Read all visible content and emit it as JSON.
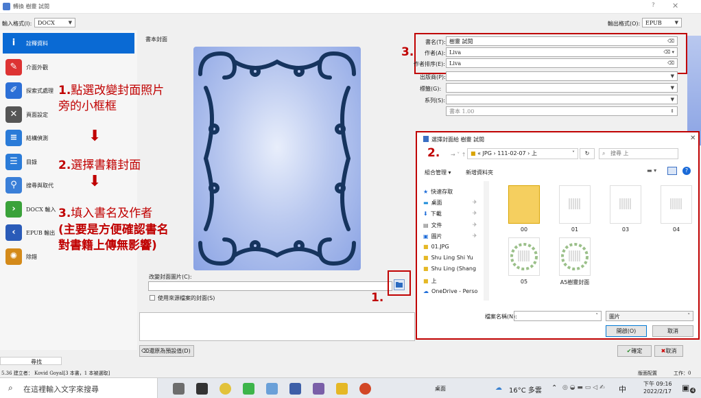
{
  "window": {
    "title": "轉換 樹靈 試閱",
    "help": "?",
    "close": "✕"
  },
  "input_format": {
    "label": "輸入格式(I):",
    "value": "DOCX"
  },
  "output_format": {
    "label": "輸出格式(O):",
    "value": "EPUB"
  },
  "sidebar": {
    "items": [
      {
        "label": "詮釋資料",
        "icon": "info-icon",
        "color": "#0a6ad4"
      },
      {
        "label": "介面外觀",
        "icon": "brush-icon",
        "color": "#d33"
      },
      {
        "label": "探索式處理",
        "icon": "document-edit-icon",
        "color": "#2c6fd6"
      },
      {
        "label": "頁面設定",
        "icon": "tools-icon",
        "color": "#555"
      },
      {
        "label": "結構偵測",
        "icon": "numbered-list-icon",
        "color": "#2a7bd8"
      },
      {
        "label": "目錄",
        "icon": "toc-icon",
        "color": "#2a7bd8"
      },
      {
        "label": "搜尋與取代",
        "icon": "magnifier-icon",
        "color": "#3a7fd8"
      },
      {
        "label": "DOCX 輸入",
        "icon": "chevron-right-icon",
        "color": "#3aa23a"
      },
      {
        "label": "EPUB 輸出",
        "icon": "chevron-left-icon",
        "color": "#2a5bb8"
      },
      {
        "label": "除錯",
        "icon": "bug-icon",
        "color": "#d48a1a"
      }
    ]
  },
  "annotations": {
    "step1_num": "1.",
    "step1_text_a": "點選改變封面照片",
    "step1_text_b": "旁的小框框",
    "arrow": "⬇",
    "step2_num": "2.",
    "step2_text": "選擇書籍封面",
    "step3_num": "3.",
    "step3_text": "填入書名及作者",
    "step3_note_a": "(主要是方便確認書名",
    "step3_note_b": "對書籍上傳無影響)",
    "marker1": "1.",
    "marker2": "2.",
    "marker3": "3."
  },
  "cover_section": {
    "title": "書本封面",
    "change_label": "改變封面圖片(C):",
    "use_source_label": "使用來源檔案的封面(S)"
  },
  "metadata": {
    "title_label": "書名(T):",
    "title_value": "樹靈 試閱",
    "author_label": "作者(A):",
    "author_value": "Liva",
    "author_sort_label": "作者排序(E):",
    "author_sort_value": "Liva",
    "publisher_label": "出版商(P):",
    "tags_label": "標籤(G):",
    "series_label": "系列(S):",
    "book_number": "書本 1.00"
  },
  "buttons": {
    "reset": "還原為預設值(D)",
    "ok": "確定",
    "cancel": "取消"
  },
  "statusbar": {
    "text": "5.36 建立者： Kovid Goyal[3 本書，1 本被選取]",
    "layout": "版面配置",
    "jobs": "工作：0",
    "left_tab": "尋找"
  },
  "file_dialog": {
    "title": "選擇封面給 樹靈 試閱",
    "path": [
      "« JPG",
      "111-02-07",
      "上"
    ],
    "search_placeholder": "搜尋 上",
    "organize": "組合管理 ▾",
    "new_folder": "新增資料夾",
    "nav": [
      {
        "label": "快速存取",
        "icon": "star-icon"
      },
      {
        "label": "桌面",
        "icon": "desktop-icon"
      },
      {
        "label": "下載",
        "icon": "download-icon"
      },
      {
        "label": "文件",
        "icon": "document-icon"
      },
      {
        "label": "圖片",
        "icon": "picture-icon"
      },
      {
        "label": "01.JPG",
        "icon": "folder-icon"
      },
      {
        "label": "Shu Ling  Shi Yu",
        "icon": "folder-icon"
      },
      {
        "label": "Shu Ling (Shang",
        "icon": "folder-icon"
      },
      {
        "label": "上",
        "icon": "folder-icon"
      },
      {
        "label": "OneDrive - Perso",
        "icon": "cloud-icon"
      }
    ],
    "files": [
      "00",
      "01",
      "03",
      "04",
      "05",
      "A5樹靈封面"
    ],
    "filename_label": "檔案名稱(N):",
    "filetype": "圖片",
    "open": "開啟(O)",
    "cancel": "取消"
  },
  "taskbar": {
    "search_placeholder": "在這裡輸入文字來搜尋",
    "desktop": "桌面",
    "weather": "16°C 多雲",
    "ime": "中",
    "time": "下午 09:16",
    "date": "2022/2/17",
    "notify_count": "4"
  }
}
